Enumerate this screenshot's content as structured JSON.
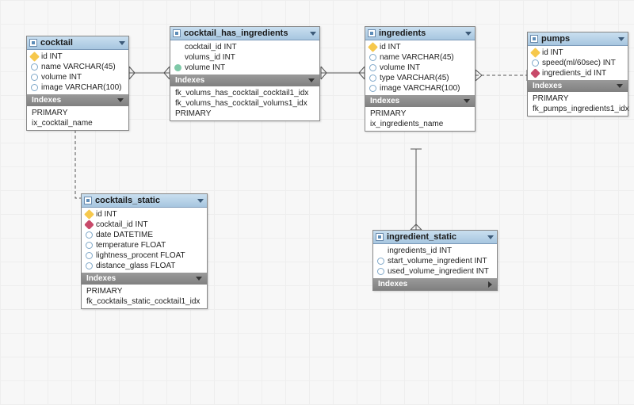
{
  "section_labels": {
    "indexes": "Indexes"
  },
  "tables": {
    "cocktail": {
      "title": "cocktail",
      "columns": [
        {
          "icon": "key",
          "text": "id INT"
        },
        {
          "icon": "dot",
          "text": "name VARCHAR(45)"
        },
        {
          "icon": "dot",
          "text": "volume INT"
        },
        {
          "icon": "dot",
          "text": "image VARCHAR(100)"
        }
      ],
      "indexes": [
        "PRIMARY",
        "ix_cocktail_name"
      ]
    },
    "cocktail_has_ingredients": {
      "title": "cocktail_has_ingredients",
      "columns": [
        {
          "icon": "none",
          "text": "cocktail_id INT"
        },
        {
          "icon": "none",
          "text": "volums_id INT"
        },
        {
          "icon": "fill",
          "text": "volume INT"
        }
      ],
      "indexes": [
        "fk_volums_has_cocktail_cocktail1_idx",
        "fk_volums_has_cocktail_volums1_idx",
        "PRIMARY"
      ]
    },
    "ingredients": {
      "title": "ingredients",
      "columns": [
        {
          "icon": "key",
          "text": "id INT"
        },
        {
          "icon": "dot",
          "text": "name VARCHAR(45)"
        },
        {
          "icon": "dot",
          "text": "volume INT"
        },
        {
          "icon": "dot",
          "text": "type VARCHAR(45)"
        },
        {
          "icon": "dot",
          "text": "image VARCHAR(100)"
        }
      ],
      "indexes": [
        "PRIMARY",
        "ix_ingredients_name"
      ]
    },
    "pumps": {
      "title": "pumps",
      "columns": [
        {
          "icon": "key",
          "text": "id INT"
        },
        {
          "icon": "dot",
          "text": "speed(ml/60sec) INT"
        },
        {
          "icon": "dia",
          "text": "ingredients_id INT"
        }
      ],
      "indexes": [
        "PRIMARY",
        "fk_pumps_ingredients1_idx"
      ]
    },
    "cocktails_static": {
      "title": "cocktails_static",
      "columns": [
        {
          "icon": "key",
          "text": "id INT"
        },
        {
          "icon": "dia",
          "text": "cocktail_id INT"
        },
        {
          "icon": "dot",
          "text": "date DATETIME"
        },
        {
          "icon": "dot",
          "text": "temperature FLOAT"
        },
        {
          "icon": "dot",
          "text": "lightness_procent FLOAT"
        },
        {
          "icon": "dot",
          "text": "distance_glass FLOAT"
        }
      ],
      "indexes": [
        "PRIMARY",
        "fk_cocktails_static_cocktail1_idx"
      ]
    },
    "ingredient_static": {
      "title": "ingredient_static",
      "columns": [
        {
          "icon": "none",
          "text": "ingredients_id INT"
        },
        {
          "icon": "dot",
          "text": "start_volume_ingredient INT"
        },
        {
          "icon": "dot",
          "text": "used_volume_ingredient INT"
        }
      ],
      "indexes": []
    }
  }
}
